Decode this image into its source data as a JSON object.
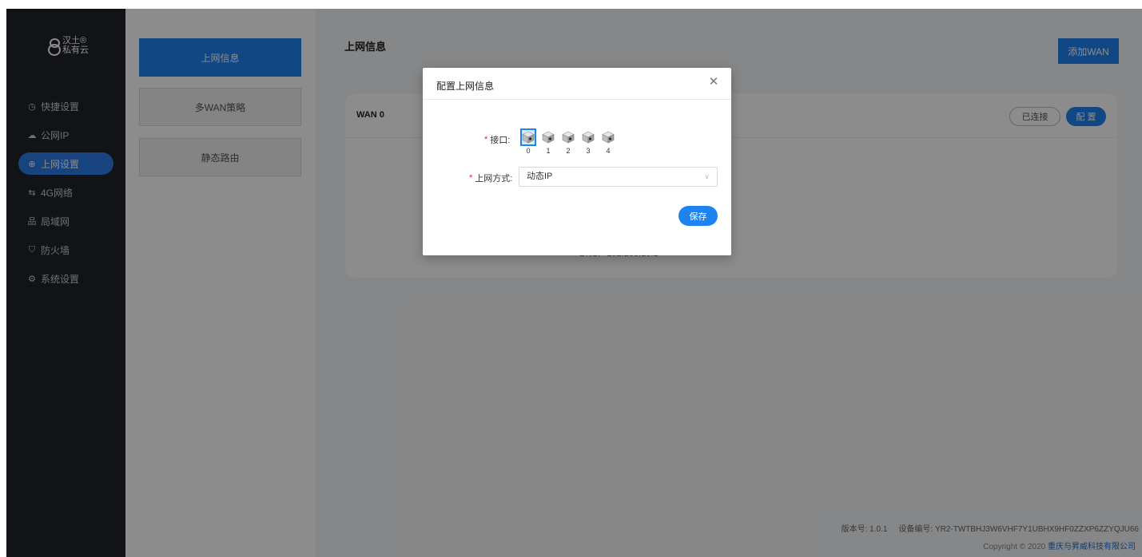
{
  "brand": {
    "line1": "汉土®",
    "line2": "私有云"
  },
  "sidebar": {
    "items": [
      {
        "label": "快捷设置",
        "icon": "clock-icon"
      },
      {
        "label": "公网IP",
        "icon": "cloud-icon"
      },
      {
        "label": "上网设置",
        "icon": "globe-icon",
        "active": true
      },
      {
        "label": "4G网络",
        "icon": "transfer-icon"
      },
      {
        "label": "局域网",
        "icon": "network-icon"
      },
      {
        "label": "防火墙",
        "icon": "shield-icon"
      },
      {
        "label": "系统设置",
        "icon": "gear-icon"
      }
    ]
  },
  "subnav": {
    "items": [
      {
        "label": "上网信息",
        "active": true
      },
      {
        "label": "多WAN策略"
      },
      {
        "label": "静态路由"
      }
    ]
  },
  "main": {
    "title": "上网信息",
    "add_button": "添加WAN",
    "wan_card": {
      "title": "WAN 0",
      "status": "已连接",
      "config_button": "配 置",
      "dns_label": "DNS:",
      "dns_value": "192.168.10.1"
    }
  },
  "footer": {
    "version_label": "版本号: 1.0.1",
    "device_label": "设备编号: YR2-TWTBHJ3W6VHF7Y1UBHX9HF0ZZXP6ZZYQJU66",
    "copyright": "Copyright © 2020",
    "company": "重庆与昇威科技有限公司"
  },
  "modal": {
    "title": "配置上网信息",
    "port_label": "接口:",
    "ports": [
      "0",
      "1",
      "2",
      "3",
      "4"
    ],
    "selected_port": "0",
    "mode_label": "上网方式:",
    "mode_value": "动态IP",
    "save_button": "保存"
  },
  "colors": {
    "accent": "#1e82f0",
    "sidebar": "#1f2329",
    "required": "#f5222d"
  }
}
